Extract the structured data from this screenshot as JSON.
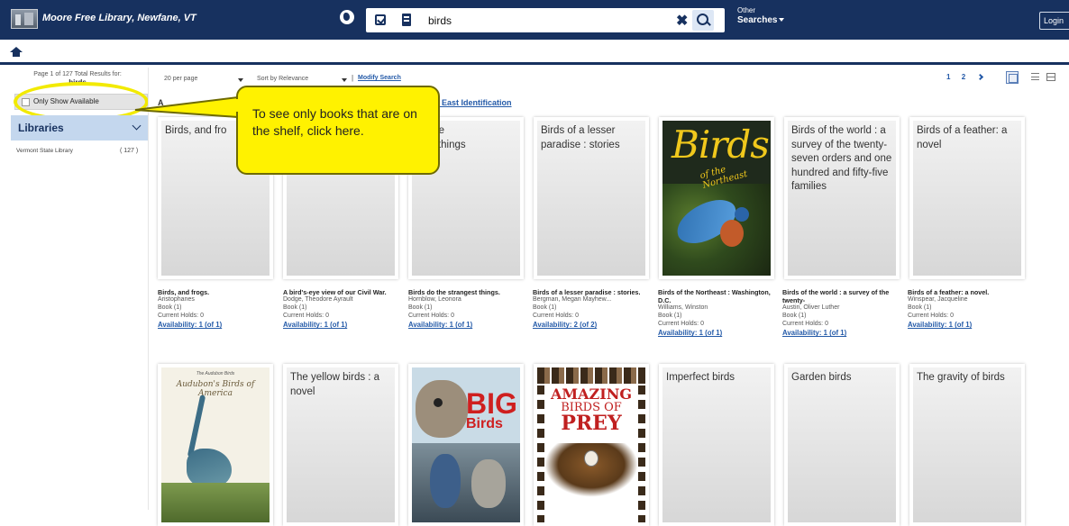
{
  "topbar": {
    "library_name": "Moore Free Library, Newfane, VT",
    "search_value": "birds",
    "other_searches_line1": "Other",
    "other_searches_line2": "Searches",
    "login_label": "Login"
  },
  "sidebar": {
    "page_info": "Page 1 of 127 Total Results for:",
    "search_term": "birds",
    "only_available_label": "Only Show Available",
    "libraries_heading": "Libraries",
    "library_rows": [
      {
        "name": "Vermont State Library",
        "count": "( 127 )"
      }
    ]
  },
  "toolbar": {
    "per_page": "20 per page",
    "sort": "Sort by Relevance",
    "separator": "|",
    "modify_search": "Modify Search",
    "pages": [
      "1",
      "2"
    ],
    "results_prefix": "A",
    "results_link": "ica East Identification"
  },
  "callout": {
    "text": "To see only books that are on the shelf, click here."
  },
  "results_row1": [
    {
      "placeholder": "Birds, and fro",
      "title": "Birds, and frogs.",
      "author": "Aristophanes",
      "format": "Book (1)",
      "holds": "Current Holds: 0",
      "availability": "Availability: 1 (of 1)"
    },
    {
      "placeholder": "",
      "title": "A bird's-eye view of our Civil War.",
      "author": "Dodge, Theodore Ayrault",
      "format": "Book (1)",
      "holds": "Current Holds: 0",
      "availability": "Availability: 1 (of 1)"
    },
    {
      "placeholder": "do the\ngest things",
      "title": "Birds do the strangest things.",
      "author": "Hornblow, Leonora",
      "format": "Book (1)",
      "holds": "Current Holds: 0",
      "availability": "Availability: 1 (of 1)"
    },
    {
      "placeholder": "Birds of a lesser paradise : stories",
      "title": "Birds of a lesser paradise : stories.",
      "author": "Bergman, Megan Mayhew...",
      "format": "Book (1)",
      "holds": "Current Holds: 0",
      "availability": "Availability: 2 (of 2)"
    },
    {
      "placeholder": "",
      "title": "Birds of the Northeast : Washington, D.C.",
      "author": "Williams, Winston",
      "format": "Book (1)",
      "holds": "Current Holds: 0",
      "availability": "Availability: 1 (of 1)",
      "cover_title": "Birds",
      "cover_sub": "of the Northeast"
    },
    {
      "placeholder": "Birds of the world : a survey of the twenty-seven orders and one hundred and fifty-five families",
      "title": "Birds of the world : a survey of the twenty-",
      "author": "Austin, Oliver Luther",
      "format": "Book (1)",
      "holds": "Current Holds: 0",
      "availability": "Availability: 1 (of 1)"
    },
    {
      "placeholder": "Birds of a feather: a novel",
      "title": "Birds of a feather: a novel.",
      "author": "Winspear, Jacqueline",
      "format": "Book (1)",
      "holds": "Current Holds: 0",
      "availability": "Availability: 1 (of 1)"
    }
  ],
  "results_row2": [
    {
      "placeholder": "",
      "cover_line1": "The Audubon Birds",
      "cover_line2": "Audubon's Birds of America"
    },
    {
      "placeholder": "The yellow birds : a novel"
    },
    {
      "placeholder": "",
      "cover_line1": "BIG",
      "cover_line2": "Birds"
    },
    {
      "placeholder": "",
      "cover_line1": "AMAZING",
      "cover_line2": "BIRDS OF",
      "cover_line3": "PREY"
    },
    {
      "placeholder": "Imperfect birds"
    },
    {
      "placeholder": "Garden birds"
    },
    {
      "placeholder": "The gravity of birds"
    }
  ],
  "colors": {
    "topbar": "#17315f",
    "link": "#245aa8",
    "callout": "#fff200"
  }
}
